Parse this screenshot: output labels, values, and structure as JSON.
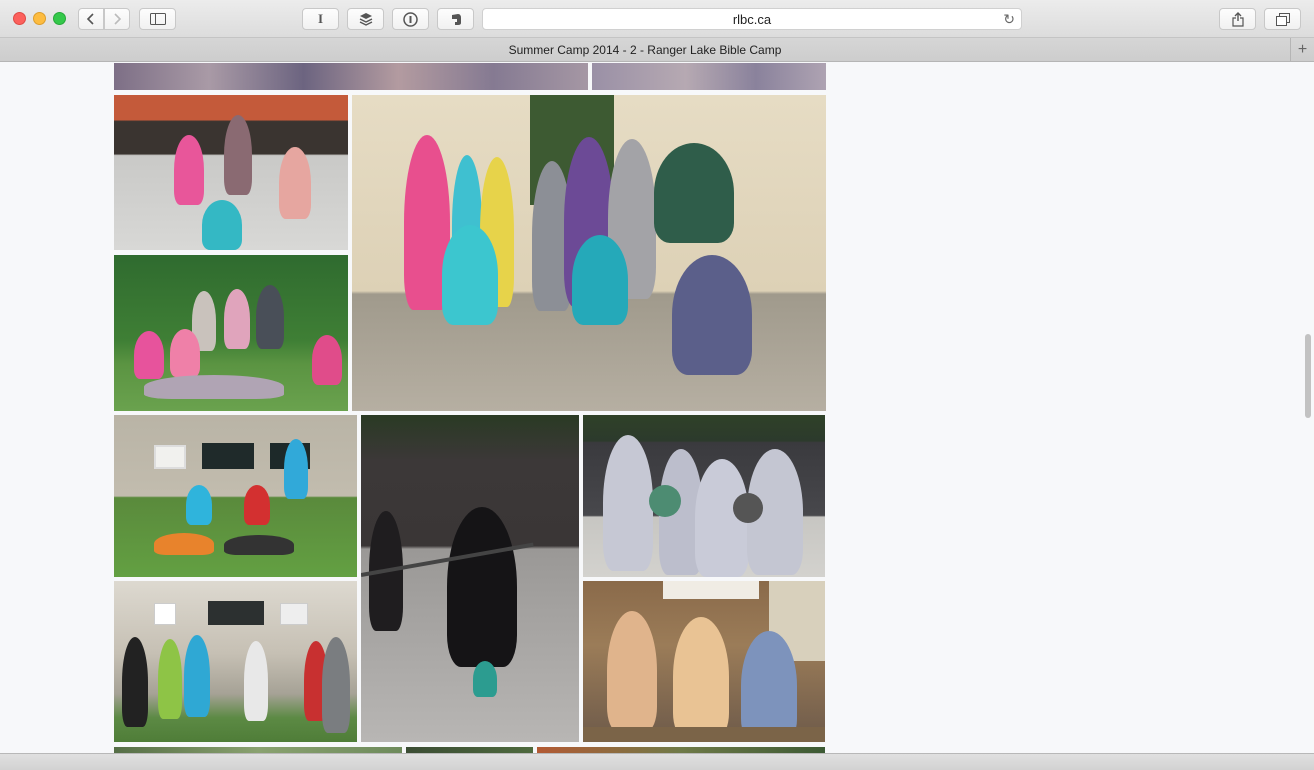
{
  "browser": {
    "url": "rlbc.ca",
    "tab_title": "Summer Camp 2014 - 2 - Ranger Lake Bible Camp",
    "reader_label": "I",
    "new_tab_label": "+"
  },
  "gallery": {
    "photos": [
      {
        "name": "lake-water-photo-left"
      },
      {
        "name": "lake-water-photo-right"
      },
      {
        "name": "girls-hockey-rink-photo"
      },
      {
        "name": "girls-group-wall-photo"
      },
      {
        "name": "girls-group-grass-photo"
      },
      {
        "name": "boys-group-building-photo"
      },
      {
        "name": "girl-floor-hockey-photo"
      },
      {
        "name": "boys-basketball-photo"
      },
      {
        "name": "boys-rock-photo"
      },
      {
        "name": "three-girls-table-photo"
      },
      {
        "name": "bottom-photo-1"
      },
      {
        "name": "bottom-photo-2"
      },
      {
        "name": "bottom-photo-3"
      }
    ]
  }
}
